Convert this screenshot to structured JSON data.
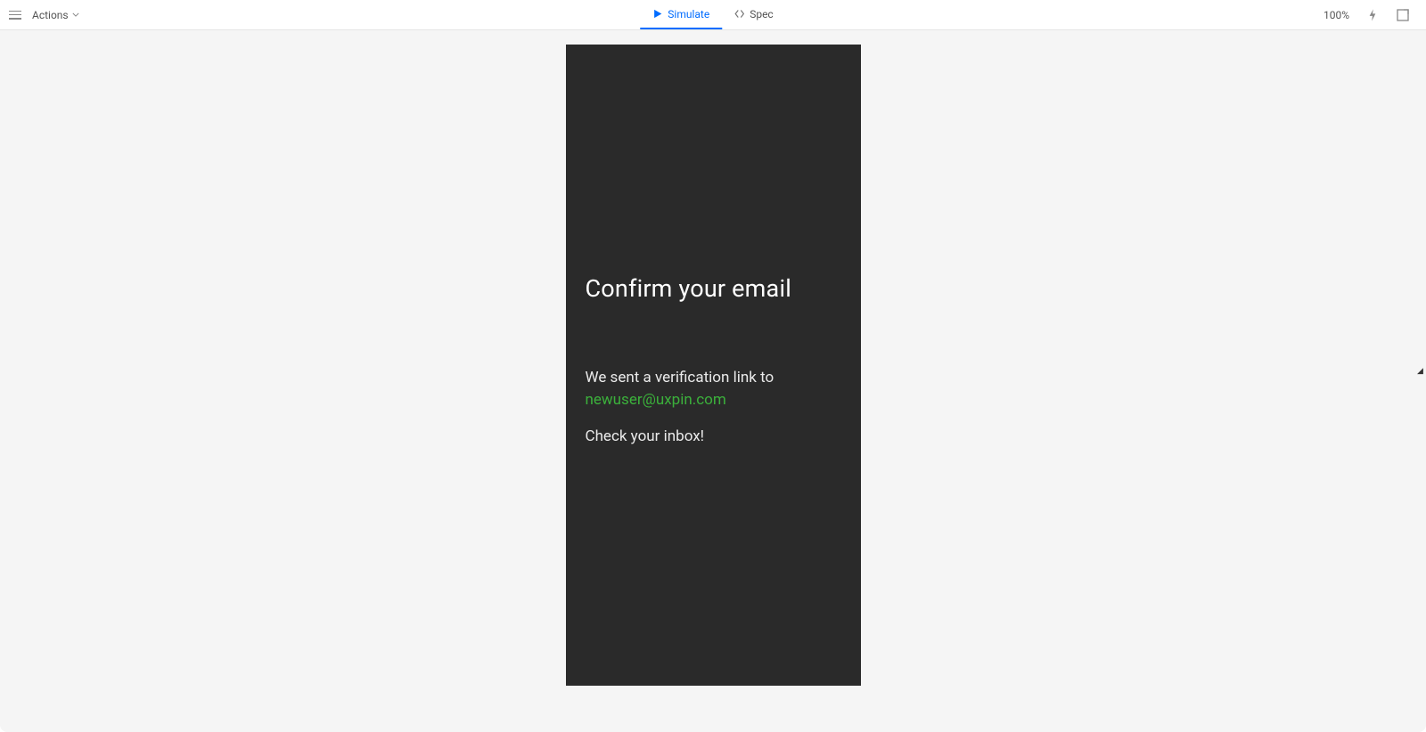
{
  "topbar": {
    "actions_label": "Actions",
    "tabs": [
      {
        "label": "Simulate",
        "active": true
      },
      {
        "label": "Spec",
        "active": false
      }
    ],
    "zoom": "100%"
  },
  "screen": {
    "title": "Confirm your email",
    "sent_line": "We sent a verification link to",
    "email": "newuser@uxpin.com",
    "check_line": "Check your inbox!"
  }
}
